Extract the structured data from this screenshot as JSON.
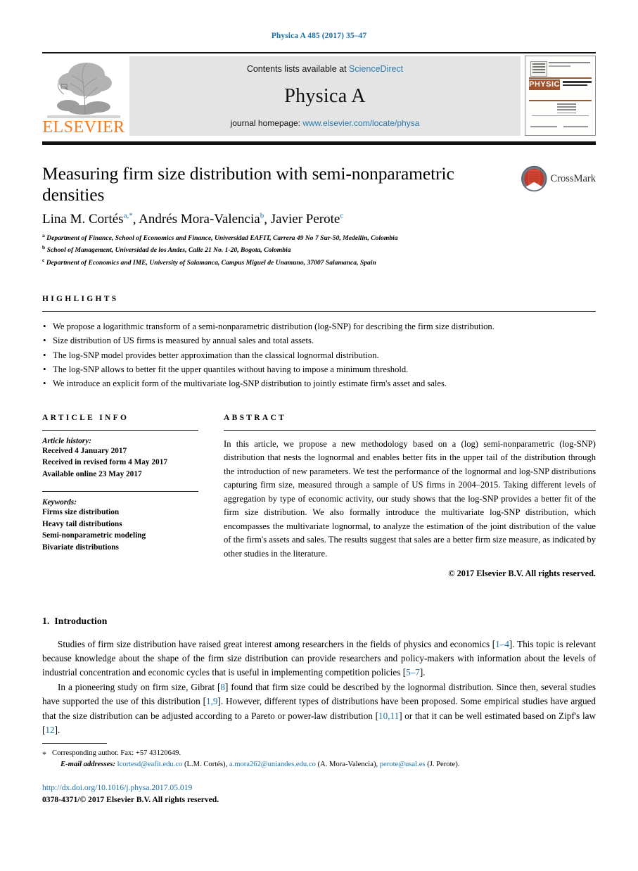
{
  "running_head": "Physica A 485 (2017) 35–47",
  "masthead": {
    "publisher_logo_text": "ELSEVIER",
    "contents_prefix": "Contents lists available at",
    "contents_link": "ScienceDirect",
    "journal_name": "Physica A",
    "homepage_prefix": "journal homepage:",
    "homepage_url": "www.elsevier.com/locate/physa",
    "cover": {
      "title": "PHYSICA",
      "subtitle": "STATISTICAL MECHANICS AND ITS APPLICATIONS"
    }
  },
  "article": {
    "title": "Measuring firm size distribution with semi-nonparametric densities",
    "authors": [
      {
        "name": "Lina M. Cortés",
        "marks": "a,*"
      },
      {
        "name": "Andrés Mora-Valencia",
        "marks": "b"
      },
      {
        "name": "Javier Perote",
        "marks": "c"
      }
    ],
    "affiliations": [
      {
        "mark": "a",
        "text": "Department of Finance, School of Economics and Finance, Universidad EAFIT, Carrera 49 No 7 Sur-50, Medellin, Colombia"
      },
      {
        "mark": "b",
        "text": "School of Management, Universidad de los Andes, Calle 21 No. 1-20, Bogota, Colombia"
      },
      {
        "mark": "c",
        "text": "Department of Economics and IME, University of Salamanca, Campus Miguel de Unamuno, 37007 Salamanca, Spain"
      }
    ],
    "crossmark_label": "CrossMark"
  },
  "highlights": {
    "heading": "HIGHLIGHTS",
    "items": [
      "We propose a logarithmic transform of a semi-nonparametric distribution (log-SNP) for describing the firm size distribution.",
      "Size distribution of US firms is measured by annual sales and total assets.",
      "The log-SNP model provides better approximation than the classical lognormal distribution.",
      "The log-SNP allows to better fit the upper quantiles without having to impose a minimum threshold.",
      "We introduce an explicit form of the multivariate log-SNP distribution to jointly estimate firm's asset and sales."
    ]
  },
  "article_info": {
    "heading": "ARTICLE INFO",
    "history_label": "Article history:",
    "history": [
      "Received 4 January 2017",
      "Received in revised form 4 May 2017",
      "Available online 23 May 2017"
    ],
    "keywords_label": "Keywords:",
    "keywords": [
      "Firms size distribution",
      "Heavy tail distributions",
      "Semi-nonparametric modeling",
      "Bivariate distributions"
    ]
  },
  "abstract": {
    "heading": "ABSTRACT",
    "body": "In this article, we propose a new methodology based on a (log) semi-nonparametric (log-SNP) distribution that nests the lognormal and enables better fits in the upper tail of the distribution through the introduction of new parameters. We test the performance of the lognormal and log-SNP distributions capturing firm size, measured through a sample of US firms in 2004–2015. Taking different levels of aggregation by type of economic activity, our study shows that the log-SNP provides a better fit of the firm size distribution. We also formally introduce the multivariate log-SNP distribution, which encompasses the multivariate lognormal, to analyze the estimation of the joint distribution of the value of the firm's assets and sales. The results suggest that sales are a better firm size measure, as indicated by other studies in the literature.",
    "copyright": "© 2017 Elsevier B.V. All rights reserved."
  },
  "introduction": {
    "number": "1.",
    "heading": "Introduction",
    "para1": {
      "s1": "Studies of firm size distribution have raised great interest among researchers in the fields of physics and economics [",
      "ref1": "1–4",
      "s2": "]. This topic is relevant because knowledge about the shape of the firm size distribution can provide researchers and policy-makers with information about the levels of industrial concentration and economic cycles that is useful in implementing competition policies [",
      "ref2": "5–7",
      "s3": "]."
    },
    "para2": {
      "s1": "In a pioneering study on firm size, Gibrat [",
      "ref1": "8",
      "s2": "] found that firm size could be described by the lognormal distribution. Since then, several studies have supported the use of this distribution [",
      "ref2": "1,9",
      "s3": "]. However, different types of distributions have been proposed. Some empirical studies have argued that the size distribution can be adjusted according to a Pareto or power-law distribution [",
      "ref3": "10,11",
      "s4": "] or that it can be well estimated based on Zipf's law [",
      "ref4": "12",
      "s5": "]."
    }
  },
  "footnote": {
    "star": "*",
    "corresponding": "Corresponding author. Fax: +57 43120649.",
    "email_label": "E-mail addresses:",
    "emails": [
      {
        "address": "lcortesd@eafit.edu.co",
        "owner": "(L.M. Cortés)"
      },
      {
        "address": "a.mora262@uniandes.edu.co",
        "owner": "(A. Mora-Valencia)"
      },
      {
        "address": "perote@usal.es",
        "owner": "(J. Perote)"
      }
    ],
    "doi": "http://dx.doi.org/10.1016/j.physa.2017.05.019",
    "issn_line": "0378-4371/© 2017 Elsevier B.V. All rights reserved."
  },
  "colors": {
    "link": "#1a6fa8",
    "elsevier_orange": "#f47b20",
    "band_gray": "#e4e4e4"
  }
}
